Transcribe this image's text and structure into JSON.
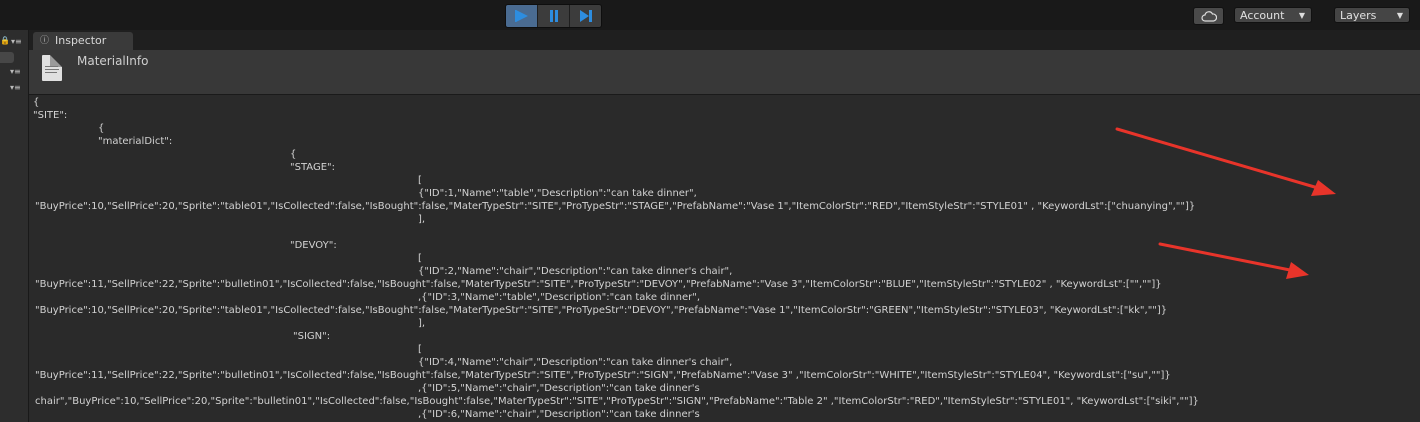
{
  "toolbar": {
    "account_label": "Account",
    "layers_label": "Layers",
    "play_icon": "play-icon",
    "pause_icon": "pause-icon",
    "step_icon": "step-icon",
    "cloud_icon": "cloud-icon"
  },
  "inspector": {
    "tab_label": "Inspector",
    "asset_name": "MaterialInfo"
  },
  "json_lines": [
    "{",
    "\"SITE\":",
    "{",
    "\"materialDict\":",
    "{",
    "\"STAGE\":",
    "[",
    "{\"ID\":1,\"Name\":\"table\",\"Description\":\"can take dinner\",",
    "\"BuyPrice\":10,\"SellPrice\":20,\"Sprite\":\"table01\",\"IsCollected\":false,\"IsBought\":false,\"MaterTypeStr\":\"SITE\",\"ProTypeStr\":\"STAGE\",\"PrefabName\":\"Vase 1\",\"ItemColorStr\":\"RED\",\"ItemStyleStr\":\"STYLE01\" , \"KeywordLst\":[\"chuanying\",\"\"]}",
    "],",
    "\"DEVOY\":",
    "[",
    "{\"ID\":2,\"Name\":\"chair\",\"Description\":\"can take dinner's chair\",",
    "\"BuyPrice\":11,\"SellPrice\":22,\"Sprite\":\"bulletin01\",\"IsCollected\":false,\"IsBought\":false,\"MaterTypeStr\":\"SITE\",\"ProTypeStr\":\"DEVOY\",\"PrefabName\":\"Vase 3\",\"ItemColorStr\":\"BLUE\",\"ItemStyleStr\":\"STYLE02\" , \"KeywordLst\":[\"\",\"\"]}",
    ",{\"ID\":3,\"Name\":\"table\",\"Description\":\"can take dinner\",",
    "\"BuyPrice\":10,\"SellPrice\":20,\"Sprite\":\"table01\",\"IsCollected\":false,\"IsBought\":false,\"MaterTypeStr\":\"SITE\",\"ProTypeStr\":\"DEVOY\",\"PrefabName\":\"Vase 1\",\"ItemColorStr\":\"GREEN\",\"ItemStyleStr\":\"STYLE03\", \"KeywordLst\":[\"kk\",\"\"]}",
    "],",
    "\"SIGN\":",
    "[",
    "{\"ID\":4,\"Name\":\"chair\",\"Description\":\"can take dinner's chair\",",
    "\"BuyPrice\":11,\"SellPrice\":22,\"Sprite\":\"bulletin01\",\"IsCollected\":false,\"IsBought\":false,\"MaterTypeStr\":\"SITE\",\"ProTypeStr\":\"SIGN\",\"PrefabName\":\"Vase 3\" ,\"ItemColorStr\":\"WHITE\",\"ItemStyleStr\":\"STYLE04\", \"KeywordLst\":[\"su\",\"\"]}",
    ",{\"ID\":5,\"Name\":\"chair\",\"Description\":\"can take dinner's",
    "chair\",\"BuyPrice\":10,\"SellPrice\":20,\"Sprite\":\"bulletin01\",\"IsCollected\":false,\"IsBought\":false,\"MaterTypeStr\":\"SITE\",\"ProTypeStr\":\"SIGN\",\"PrefabName\":\"Table 2\" ,\"ItemColorStr\":\"RED\",\"ItemStyleStr\":\"STYLE01\", \"KeywordLst\":[\"siki\",\"\"]}",
    ",{\"ID\":6,\"Name\":\"chair\",\"Description\":\"can take dinner's"
  ],
  "colors": {
    "annotation_arrow": "#e8342a",
    "play_active": "#4a6b91"
  }
}
